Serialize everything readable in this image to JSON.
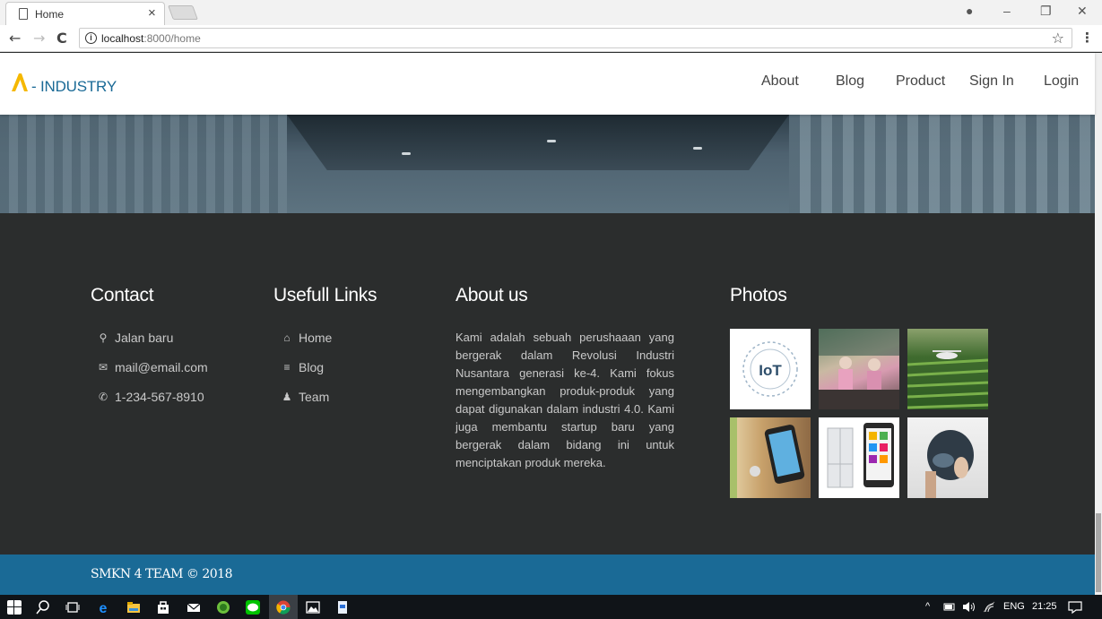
{
  "browser": {
    "tab_title": "Home",
    "tab_close": "×",
    "url_host": "localhost",
    "url_rest": ":8000/home",
    "info_icon": "i",
    "back_icon": "←",
    "forward_icon": "→",
    "reload_icon": "C",
    "star_icon": "☆",
    "menu_icon": "⋮",
    "win_minimize": "–",
    "win_restore": "❐",
    "win_close": "✕",
    "account_icon": "●"
  },
  "header": {
    "logo_text": "- INDUSTRY",
    "nav": [
      "About",
      "Blog",
      "Product",
      "Sign In",
      "Login"
    ]
  },
  "footer": {
    "contact": {
      "title": "Contact",
      "items": [
        {
          "icon": "map-marker-icon",
          "glyph": "⚲",
          "text": "Jalan baru"
        },
        {
          "icon": "envelope-icon",
          "glyph": "✉",
          "text": "mail@email.com"
        },
        {
          "icon": "phone-icon",
          "glyph": "✆",
          "text": "1-234-567-8910"
        }
      ]
    },
    "links": {
      "title": "Usefull Links",
      "items": [
        {
          "icon": "home-icon",
          "glyph": "⌂",
          "text": "Home"
        },
        {
          "icon": "list-icon",
          "glyph": "≡",
          "text": "Blog"
        },
        {
          "icon": "user-icon",
          "glyph": "♟",
          "text": "Team"
        }
      ]
    },
    "about": {
      "title": "About us",
      "text": "Kami adalah sebuah perushaaan yang bergerak dalam Revolusi Industri Nusantara generasi ke-4. Kami fokus mengembangkan produk-produk yang dapat digunakan dalam industri 4.0. Kami juga membantu startup baru yang bergerak dalam bidang ini untuk menciptakan produk mereka."
    },
    "photos": {
      "title": "Photos",
      "items": [
        "iot-photo",
        "factory-workers-photo",
        "drone-field-photo",
        "smart-lock-photo",
        "smart-fridge-photo",
        "smart-helmet-photo"
      ],
      "iot_label": "IoT"
    }
  },
  "copyright": "SMKN 4 TEAM © 2018",
  "taskbar": {
    "lang": "ENG",
    "time": "21:25"
  },
  "colors": {
    "brand_blue": "#1a6a96",
    "logo_yellow": "#f5b800",
    "footer_bg": "#2b2d2d"
  }
}
